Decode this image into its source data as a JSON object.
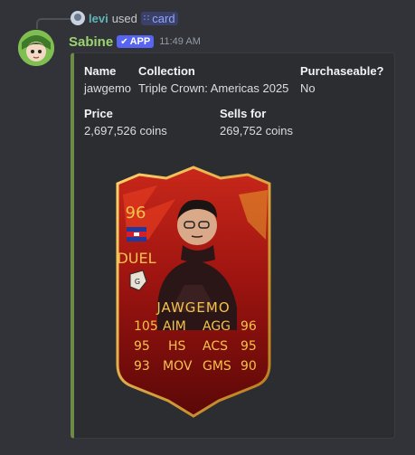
{
  "reply": {
    "user": "levi",
    "used": "used",
    "command": "card",
    "command_icon": "slash-command-icon"
  },
  "message": {
    "author": "Sabine",
    "badge": "APP",
    "timestamp": "11:49 AM"
  },
  "embed": {
    "accent_color": "#6e8a48",
    "fields": {
      "name": {
        "name": "Name",
        "value": "jawgemo"
      },
      "collection": {
        "name": "Collection",
        "value": "Triple Crown: Americas 2025"
      },
      "purchaseable": {
        "name": "Purchaseable?",
        "value": "No"
      },
      "price": {
        "name": "Price",
        "value": "2,697,526 coins"
      },
      "sells_for": {
        "name": "Sells for",
        "value": "269,752 coins"
      }
    }
  },
  "card": {
    "rating": "96",
    "position": "DUEL",
    "player": "JAWGEMO",
    "stats": [
      {
        "label": "AIM",
        "value": "105"
      },
      {
        "label": "AGG",
        "value": "96"
      },
      {
        "label": "HS",
        "value": "95"
      },
      {
        "label": "ACS",
        "value": "95"
      },
      {
        "label": "MOV",
        "value": "93"
      },
      {
        "label": "GMS",
        "value": "90"
      }
    ],
    "colors": {
      "base": "#8a0d0d",
      "text": "#f4c24a"
    }
  }
}
